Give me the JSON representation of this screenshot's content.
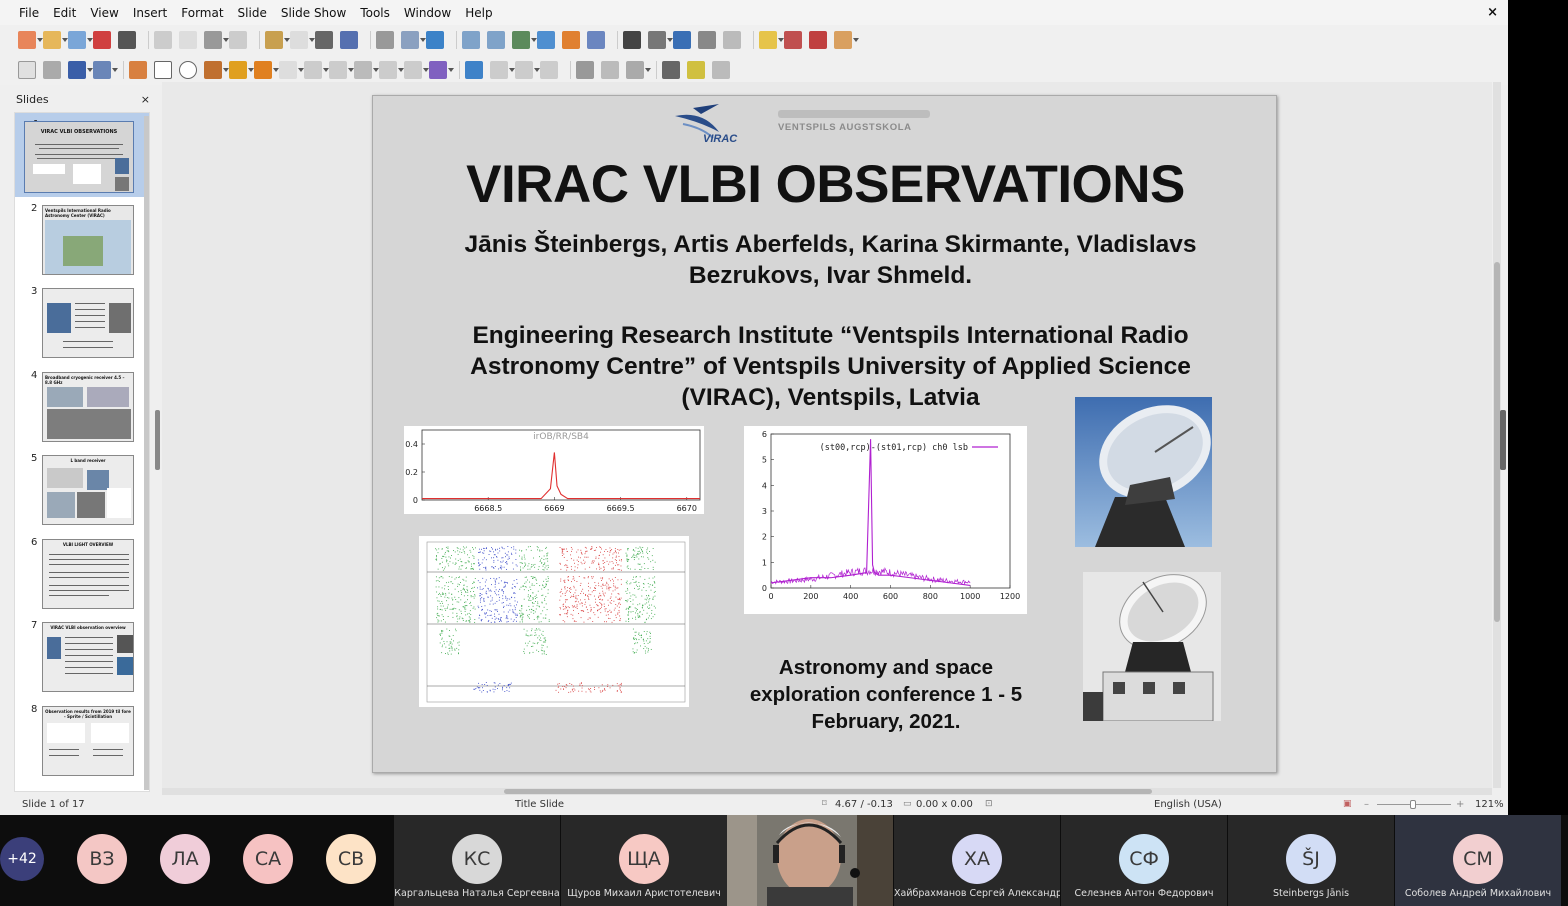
{
  "menu": [
    "File",
    "Edit",
    "View",
    "Insert",
    "Format",
    "Slide",
    "Slide Show",
    "Tools",
    "Window",
    "Help"
  ],
  "close_glyph": "×",
  "slides_panel": {
    "title": "Slides",
    "close_glyph": "×",
    "numbers": [
      "1",
      "2",
      "3",
      "4",
      "5",
      "6",
      "7",
      "8"
    ],
    "thumb_titles": [
      "VIRAC VLBI OBSERVATIONS",
      "Ventspils International Radio Astronomy Center (VIRAC)",
      "",
      "Broadband cryogenic receiver 4.5 – 8.8 GHz",
      "L band receiver",
      "VLBI LIGHT OVERVIEW",
      "VIRAC VLBI observation overview",
      "Observation results from 2019 til fore - Sprite / Scintillation"
    ]
  },
  "slide": {
    "logo_virac": "VIRAC",
    "logo_vent": "VENTSPILS AUGSTSKOLA",
    "title": "VIRAC VLBI OBSERVATIONS",
    "authors_line1": "Jānis Šteinbergs, Artis Aberfelds, Karina Skirmante, Vladislavs",
    "authors_line2": "Bezrukovs, Ivar Shmeld.",
    "affil_line1": "Engineering Research Institute “Ventspils International Radio",
    "affil_line2": "Astronomy Centre” of Ventspils University of Applied Science",
    "affil_line3": "(VIRAC), Ventspils, Latvia",
    "conf_line1": "Astronomy and space",
    "conf_line2": "exploration conference 1 - 5",
    "conf_line3": "February, 2021."
  },
  "chart_data": [
    {
      "type": "line",
      "title": "irOB/RR/SB4",
      "x_ticks": [
        "6668.5",
        "6669",
        "6669.5",
        "6670"
      ],
      "y_ticks": [
        "0",
        "0.2",
        "0.4"
      ],
      "ylim": [
        0,
        0.5
      ],
      "xlim": [
        6668.0,
        6670.1
      ],
      "series": [
        {
          "x": [
            6668.0,
            6668.9,
            6668.97,
            6669.0,
            6669.02,
            6669.05,
            6669.1,
            6670.1
          ],
          "y": [
            0.01,
            0.01,
            0.08,
            0.34,
            0.1,
            0.04,
            0.01,
            0.01
          ]
        }
      ],
      "color": "#e03030"
    },
    {
      "type": "line",
      "legend": "(st00,rcp)-(st01,rcp) ch0 lsb",
      "x_ticks": [
        "0",
        "200",
        "400",
        "600",
        "800",
        "1000",
        "1200"
      ],
      "y_ticks": [
        "0",
        "1",
        "2",
        "3",
        "4",
        "5",
        "6"
      ],
      "xlim": [
        0,
        1200
      ],
      "ylim": [
        0,
        6
      ],
      "series": [
        {
          "x": [
            0,
            100,
            200,
            300,
            400,
            480,
            500,
            510,
            520,
            540,
            600,
            700,
            800,
            900,
            1000
          ],
          "y": [
            0.2,
            0.3,
            0.4,
            0.4,
            0.5,
            0.6,
            5.8,
            0.9,
            0.6,
            0.5,
            0.5,
            0.4,
            0.3,
            0.2,
            0.1
          ]
        }
      ],
      "color": "#b020d0"
    }
  ],
  "status": {
    "slide": "Slide 1 of 17",
    "layout": "Title Slide",
    "position": "4.67 / -0.13",
    "size": "0.00 x 0.00",
    "language": "English (USA)",
    "zoom": "121%"
  },
  "participants": [
    {
      "initials": "+42",
      "name": "",
      "color": "#3b3f7a"
    },
    {
      "initials": "ВЗ",
      "name": "",
      "color": "#f4c7c5"
    },
    {
      "initials": "ЛА",
      "name": "",
      "color": "#f0cdd9"
    },
    {
      "initials": "СА",
      "name": "",
      "color": "#f6c2c2"
    },
    {
      "initials": "СВ",
      "name": "",
      "color": "#fde3c6"
    },
    {
      "initials": "КС",
      "name": "Каргальцева Наталья Сергеевна",
      "color": "#d8d8d8"
    },
    {
      "initials": "ЩА",
      "name": "Щуров Михаил Аристотелевич",
      "color": "#f7c9c4"
    },
    {
      "initials": "ХА",
      "name": "Хайбрахманов Сергей Александр...",
      "color": "#d7d9f5"
    },
    {
      "initials": "СФ",
      "name": "Селезнев Антон Федорович",
      "color": "#cde3f5"
    },
    {
      "initials": "ŠJ",
      "name": "Šteinbergs Jānis",
      "color": "#d2ddf5"
    },
    {
      "initials": "СМ",
      "name": "Соболев Андрей Михайлович",
      "color": "#f2cfd0"
    }
  ]
}
